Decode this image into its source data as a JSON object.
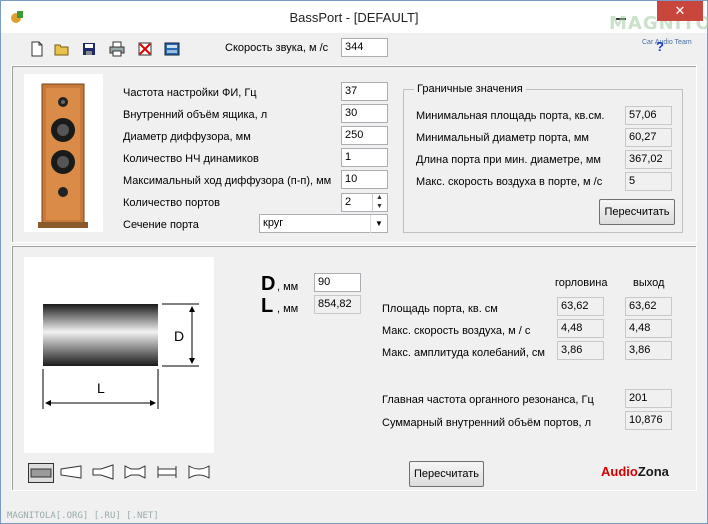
{
  "window": {
    "title": "BassPort - [DEFAULT]",
    "close_glyph": "✕"
  },
  "watermark": {
    "brand": "MAGNITOLA",
    "sub": "Car Audio Team"
  },
  "toolbar": {
    "icons": [
      "new-file-icon",
      "open-folder-icon",
      "save-icon",
      "print-icon",
      "clear-icon",
      "calculator-icon",
      "help-icon"
    ],
    "sound_speed_label": "Скорость звука, м /с",
    "sound_speed_value": "344",
    "help_glyph": "?"
  },
  "params": {
    "tuning_freq_label": "Частота настройки ФИ, Гц",
    "tuning_freq_value": "37",
    "box_volume_label": "Внутренний объём ящика, л",
    "box_volume_value": "30",
    "cone_diameter_label": "Диаметр диффузора, мм",
    "cone_diameter_value": "250",
    "woofer_count_label": "Количество НЧ динамиков",
    "woofer_count_value": "1",
    "max_excursion_label": "Максимальный ход диффузора (п-п), мм",
    "max_excursion_value": "10",
    "port_count_label": "Количество портов",
    "port_count_value": "2",
    "port_section_label": "Сечение порта",
    "port_section_value": "круг"
  },
  "limits": {
    "title": "Граничные значения",
    "min_area_label": "Минимальная площадь порта, кв.см.",
    "min_area_value": "57,06",
    "min_diameter_label": "Минимальный диаметр порта, мм",
    "min_diameter_value": "60,27",
    "port_length_label": "Длина порта при мин. диаметре, мм",
    "port_length_value": "367,02",
    "max_air_speed_label": "Макс. скорость воздуха в порте, м /с",
    "max_air_speed_value": "5",
    "recalc_label": "Пересчитать"
  },
  "port": {
    "d_letter": "D",
    "l_letter": "L",
    "unit": ", мм",
    "d_value": "90",
    "l_value": "854,82",
    "drawing_d": "D",
    "drawing_l": "L"
  },
  "results": {
    "col_throat": "горловина",
    "col_exit": "выход",
    "area_label": "Площадь порта, кв. см",
    "area_throat": "63,62",
    "area_exit": "63,62",
    "air_speed_label": "Макс. скорость воздуха, м / с",
    "air_speed_throat": "4,48",
    "air_speed_exit": "4,48",
    "amplitude_label": "Макс. амплитуда колебаний, см",
    "amplitude_throat": "3,86",
    "amplitude_exit": "3,86",
    "organ_freq_label": "Главная частота органного резонанса, Гц",
    "organ_freq_value": "201",
    "total_volume_label": "Суммарный внутренний объём портов, л",
    "total_volume_value": "10,876",
    "recalc_label": "Пересчитать"
  },
  "shape_buttons": [
    "straight-port-icon",
    "flared-one-end-icon",
    "cone-port-icon",
    "double-flare-icon",
    "flanged-port-icon",
    "bell-port-icon"
  ],
  "brand": {
    "audio": "Audio",
    "zona": "Zona"
  },
  "footer": "MAGNITOLA[.ORG] [.RU] [.NET]"
}
